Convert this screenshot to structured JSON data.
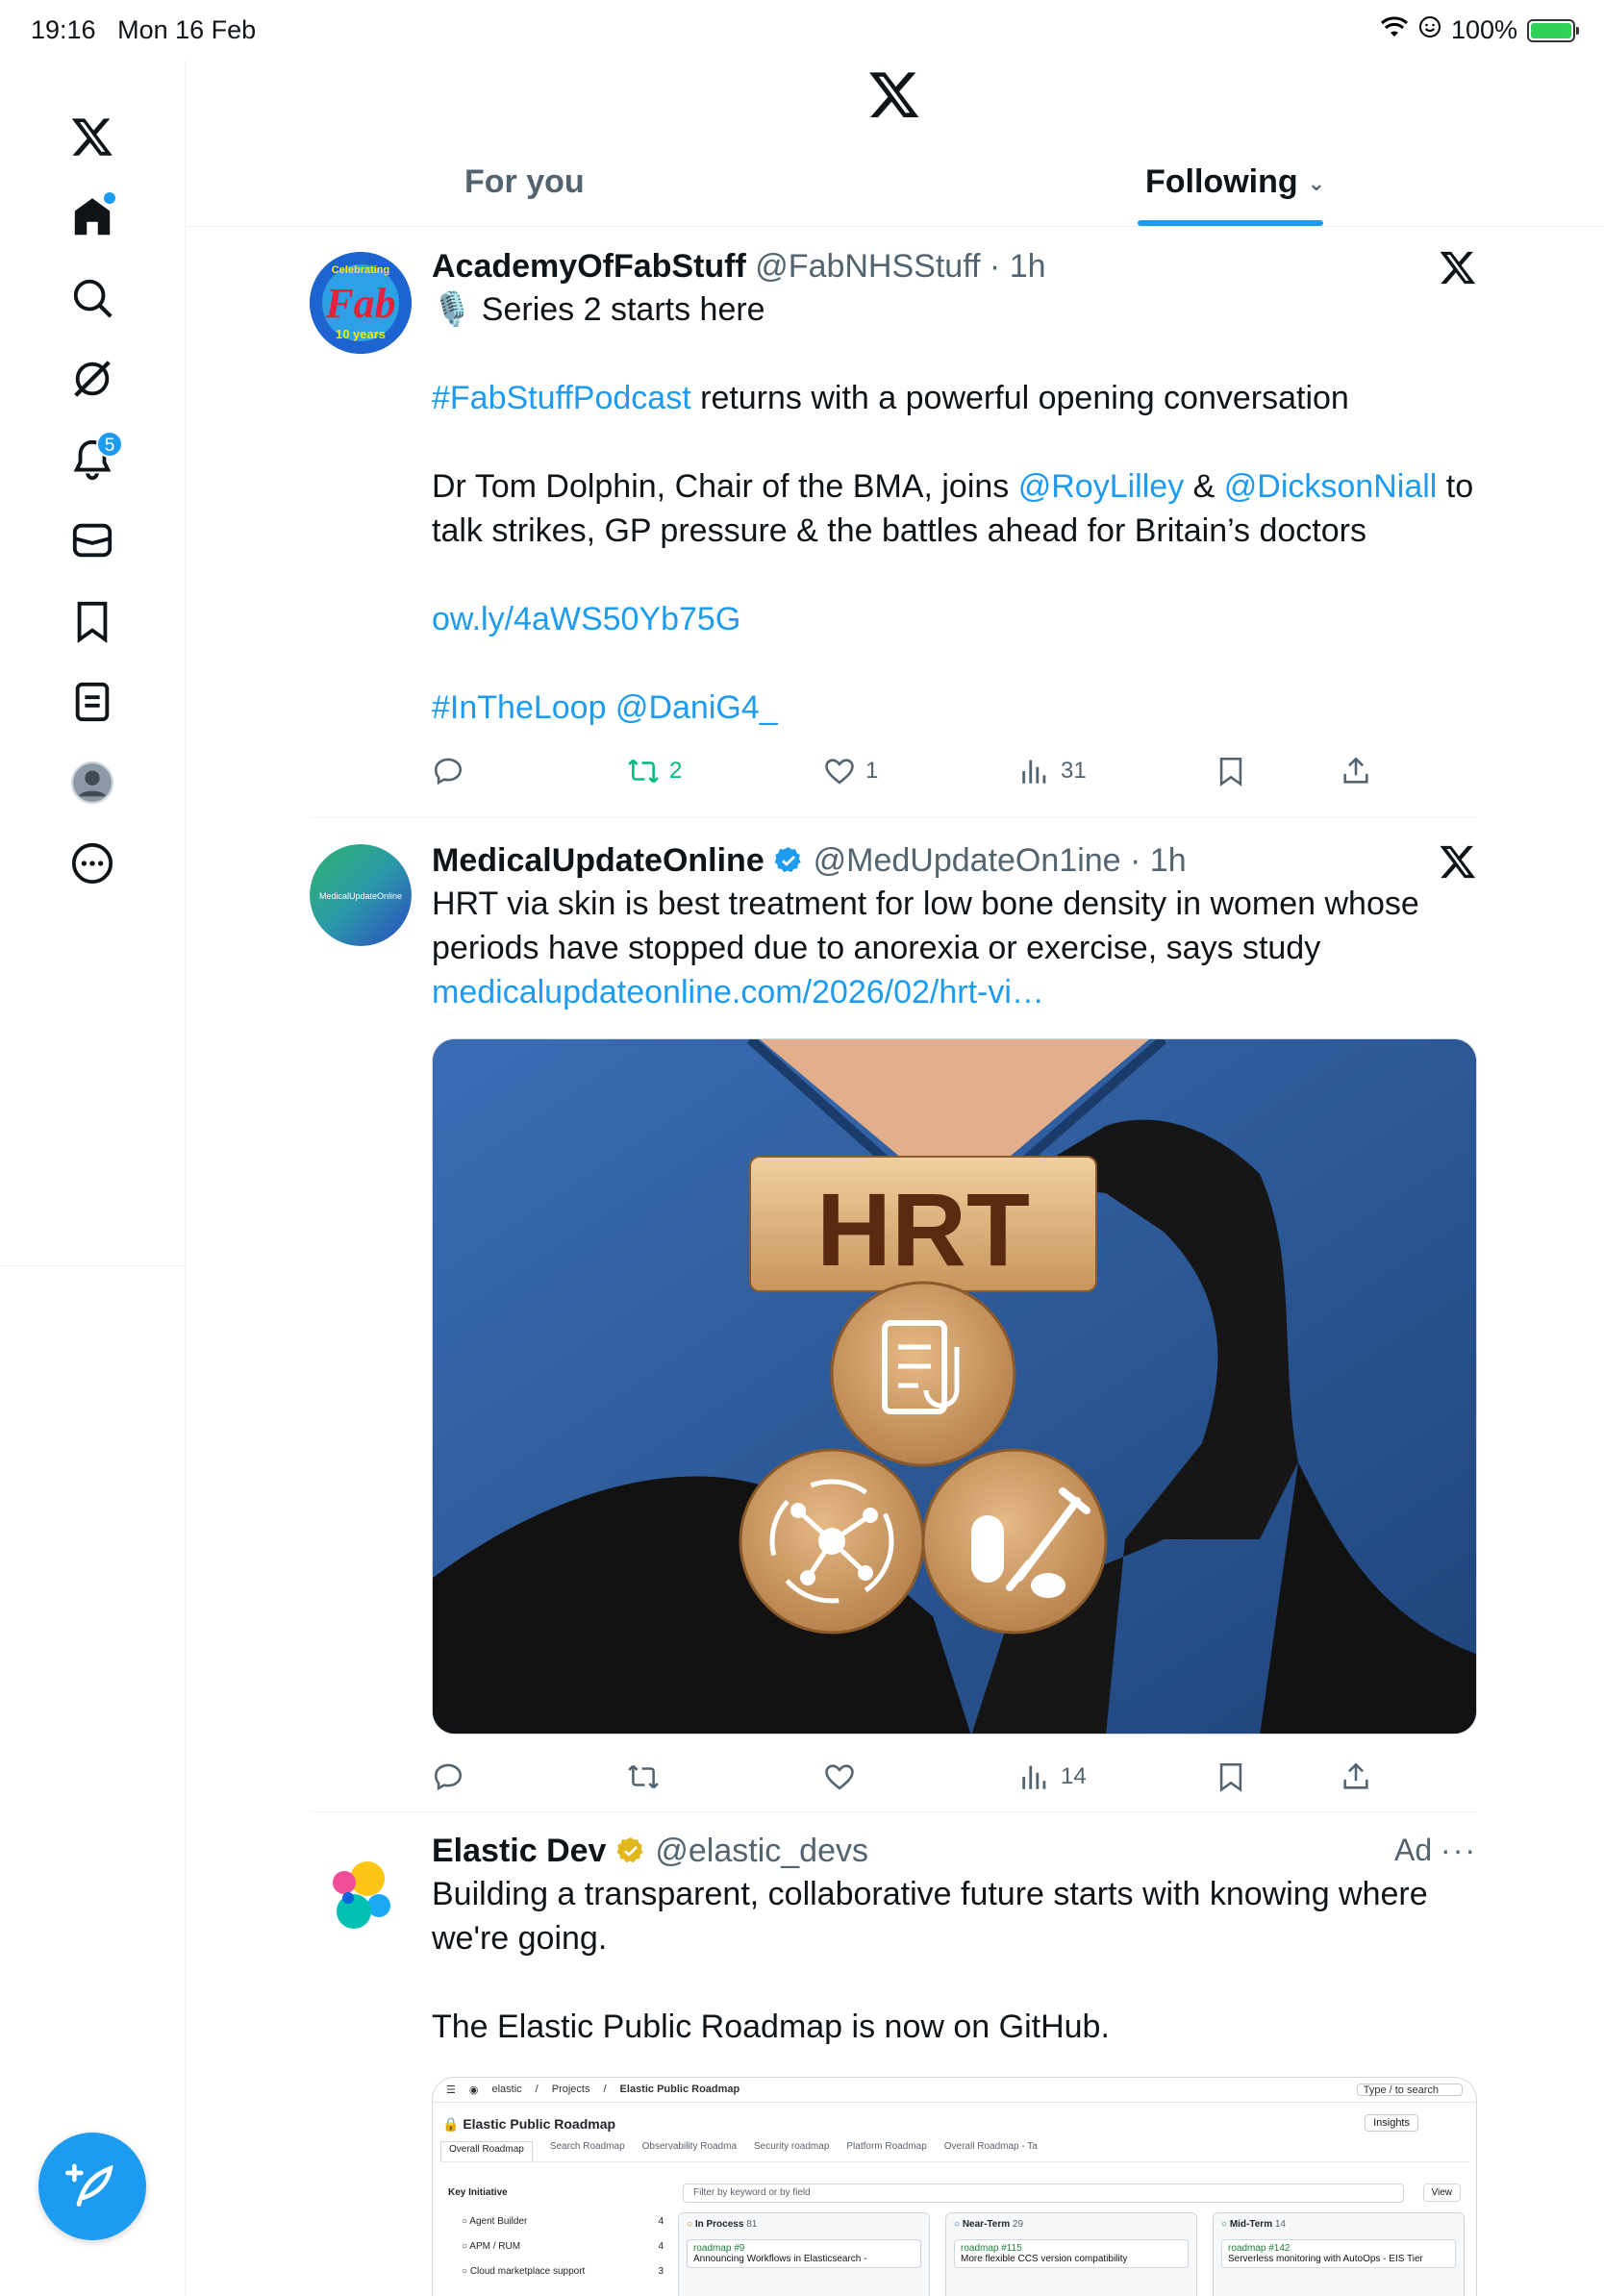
{
  "status_bar": {
    "time": "19:16",
    "date": "Mon 16 Feb",
    "battery": "100%"
  },
  "sidebar": {
    "notifications_count": "5"
  },
  "tabs": {
    "for_you": "For you",
    "following": "Following"
  },
  "posts": [
    {
      "name": "AcademyOfFabStuff",
      "handle": "@FabNHSStuff",
      "time": "1h",
      "line1": "Series 2 starts here",
      "hashtag1": "#FabStuffPodcast",
      "line2_rest": " returns with a powerful opening conversation",
      "line3_a": "Dr Tom Dolphin, Chair of the BMA, joins ",
      "mention1": "@RoyLilley",
      "line3_b": " & ",
      "mention2": "@DicksonNiall",
      "line3_c": " to talk strikes, GP pressure & the battles ahead for Britain’s doctors",
      "url": "ow.ly/4aWS50Yb75G",
      "tags": "#InTheLoop @DaniG4_",
      "retweets": "2",
      "likes": "1",
      "views": "31",
      "avatar_text_top": "Celebrating",
      "avatar_text_main": "Fab",
      "avatar_text_bottom": "10 years"
    },
    {
      "name": "MedicalUpdateOnline",
      "handle": "@MedUpdateOn1ine",
      "time": "1h",
      "text": "HRT via skin is best treatment for low bone density in women whose periods have stopped due to anorexia or exercise, says study",
      "url": "medicalupdateonline.com/2026/02/hrt-vi…",
      "image_label": "HRT",
      "views": "14",
      "avatar_text": "MedicalUpdateOnline"
    },
    {
      "name": "Elastic Dev",
      "handle": "@elastic_devs",
      "ad_label": "Ad",
      "text1": "Building a transparent, collaborative future starts with knowing where we're going.",
      "text2": "The Elastic Public Roadmap is now on GitHub.",
      "preview": {
        "breadcrumb": [
          "elastic",
          "Projects",
          "Elastic Public Roadmap"
        ],
        "search": "Type / to search",
        "title": "Elastic Public Roadmap",
        "insights": "Insights",
        "views": [
          "Overall Roadmap",
          "Search Roadmap",
          "Observability Roadma",
          "Security roadmap",
          "Platform Roadmap",
          "Overall Roadmap - Ta"
        ],
        "filter_label": "Key Initiative",
        "filter_placeholder": "Filter by keyword or by field",
        "view_button": "View",
        "initiatives": [
          {
            "name": "Agent Builder",
            "count": "4"
          },
          {
            "name": "APM / RUM",
            "count": "4"
          },
          {
            "name": "Cloud marketplace support",
            "count": "3"
          }
        ],
        "columns": [
          {
            "name": "In Process",
            "count": "81",
            "item_id": "roadmap #9",
            "item_title": "Announcing Workflows in Elasticsearch -"
          },
          {
            "name": "Near-Term",
            "count": "29",
            "item_id": "roadmap #115",
            "item_title": "More flexible CCS version compatibility"
          },
          {
            "name": "Mid-Term",
            "count": "14",
            "item_id": "roadmap #142",
            "item_title": "Serverless monitoring with AutoOps - EIS Tier"
          }
        ]
      }
    }
  ],
  "colors": {
    "accent": "#1d9bf0",
    "text": "#0f1419",
    "muted": "#536471",
    "retweet": "#00ba7c"
  }
}
